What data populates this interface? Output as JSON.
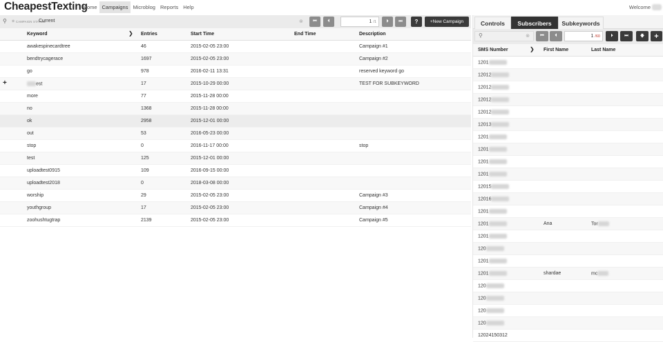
{
  "header": {
    "brand": "CheapestTexting",
    "nav": [
      "Home",
      "Campaigns",
      "Microblog",
      "Reports",
      "Help"
    ],
    "active_nav": "Campaigns",
    "welcome": "Welcome"
  },
  "campaigns": {
    "filter": {
      "status_label": "CAMPAIGN STATUS:",
      "status_value": "Current"
    },
    "pager": {
      "page": "1",
      "of": "/1"
    },
    "help_label": "?",
    "new_campaign_label": "+New Campaign",
    "columns": [
      "Keyword",
      "Entries",
      "Start Time",
      "End Time",
      "Description"
    ],
    "rows": [
      {
        "keyword": "awakespinecardtree",
        "entries": "46",
        "start": "2015-02-05 23:00",
        "end": "",
        "description": "Campaign #1"
      },
      {
        "keyword": "bendtrycagerace",
        "entries": "1697",
        "start": "2015-02-05 23:00",
        "end": "",
        "description": "Campaign #2"
      },
      {
        "keyword": "go",
        "entries": "978",
        "start": "2016-02-11 13:31",
        "end": "",
        "description": "reserved keyword go"
      },
      {
        "keyword": "est",
        "entries": "17",
        "start": "2015-10-29 00:00",
        "end": "",
        "description": "TEST FOR SUBKEYWORD",
        "expand": "+",
        "blurred_prefix": true
      },
      {
        "keyword": "more",
        "entries": "77",
        "start": "2015-11-28 00:00",
        "end": "",
        "description": ""
      },
      {
        "keyword": "no",
        "entries": "1368",
        "start": "2015-11-28 00:00",
        "end": "",
        "description": ""
      },
      {
        "keyword": "ok",
        "entries": "2958",
        "start": "2015-12-01 00:00",
        "end": "",
        "description": "",
        "selected": true
      },
      {
        "keyword": "out",
        "entries": "53",
        "start": "2016-05-23 00:00",
        "end": "",
        "description": ""
      },
      {
        "keyword": "stop",
        "entries": "0",
        "start": "2016-11-17 00:00",
        "end": "",
        "description": "stop"
      },
      {
        "keyword": "test",
        "entries": "125",
        "start": "2015-12-01 00:00",
        "end": "",
        "description": ""
      },
      {
        "keyword": "uploadtest0915",
        "entries": "109",
        "start": "2016-09-15 00:00",
        "end": "",
        "description": ""
      },
      {
        "keyword": "uploadtest2018",
        "entries": "0",
        "start": "2018-03-08 00:00",
        "end": "",
        "description": ""
      },
      {
        "keyword": "worship",
        "entries": "29",
        "start": "2015-02-05 23:00",
        "end": "",
        "description": "Campaign #3"
      },
      {
        "keyword": "youthgroup",
        "entries": "17",
        "start": "2015-02-05 23:00",
        "end": "",
        "description": "Campaign #4"
      },
      {
        "keyword": "zoohushtugtrap",
        "entries": "2139",
        "start": "2015-02-05 23:00",
        "end": "",
        "description": "Campaign #5"
      }
    ]
  },
  "panel": {
    "tabs": [
      "Controls",
      "Subscribers",
      "Subkeywords"
    ],
    "active_tab": "Subscribers",
    "pager": {
      "page": "1",
      "of": "/60"
    },
    "columns": [
      "SMS Number",
      "First Name",
      "Last Name"
    ],
    "rows": [
      {
        "sms": "1201",
        "first": "",
        "last": ""
      },
      {
        "sms": "12012",
        "first": "",
        "last": ""
      },
      {
        "sms": "12012",
        "first": "",
        "last": ""
      },
      {
        "sms": "12012",
        "first": "",
        "last": ""
      },
      {
        "sms": "12012",
        "first": "",
        "last": ""
      },
      {
        "sms": "12013",
        "first": "",
        "last": ""
      },
      {
        "sms": "1201",
        "first": "",
        "last": ""
      },
      {
        "sms": "1201",
        "first": "",
        "last": ""
      },
      {
        "sms": "1201",
        "first": "",
        "last": ""
      },
      {
        "sms": "1201",
        "first": "",
        "last": ""
      },
      {
        "sms": "12015",
        "first": "",
        "last": ""
      },
      {
        "sms": "12016",
        "first": "",
        "last": ""
      },
      {
        "sms": "1201",
        "first": "",
        "last": ""
      },
      {
        "sms": "1201",
        "first": "Ana",
        "last": "Tor"
      },
      {
        "sms": "1201",
        "first": "",
        "last": ""
      },
      {
        "sms": "120",
        "first": "",
        "last": ""
      },
      {
        "sms": "1201",
        "first": "",
        "last": ""
      },
      {
        "sms": "1201",
        "first": "shardae",
        "last": "mc"
      },
      {
        "sms": "120",
        "first": "",
        "last": ""
      },
      {
        "sms": "120",
        "first": "",
        "last": ""
      },
      {
        "sms": "120",
        "first": "",
        "last": ""
      },
      {
        "sms": "120",
        "first": "",
        "last": ""
      },
      {
        "sms": "12024150312",
        "first": "",
        "last": ""
      }
    ]
  }
}
